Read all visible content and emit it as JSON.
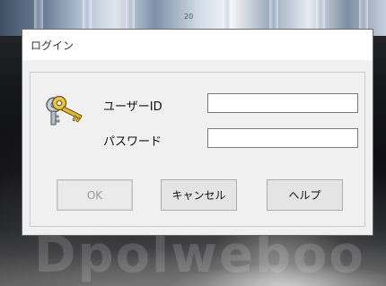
{
  "dialog": {
    "title": "ログイン",
    "fields": {
      "user_id": {
        "label": "ユーザーID",
        "value": "",
        "placeholder": ""
      },
      "password": {
        "label": "パスワード",
        "value": "",
        "placeholder": ""
      }
    },
    "buttons": {
      "ok": "OK",
      "cancel": "キャンセル",
      "help": "ヘルプ"
    },
    "icon": "keys-icon"
  },
  "background": {
    "watermark": "Dpolweboo",
    "top_text": "20"
  },
  "colors": {
    "dialog_bg": "#f0f0f0",
    "title_bg": "#ffffff",
    "disabled_text": "#9a9a9a"
  }
}
